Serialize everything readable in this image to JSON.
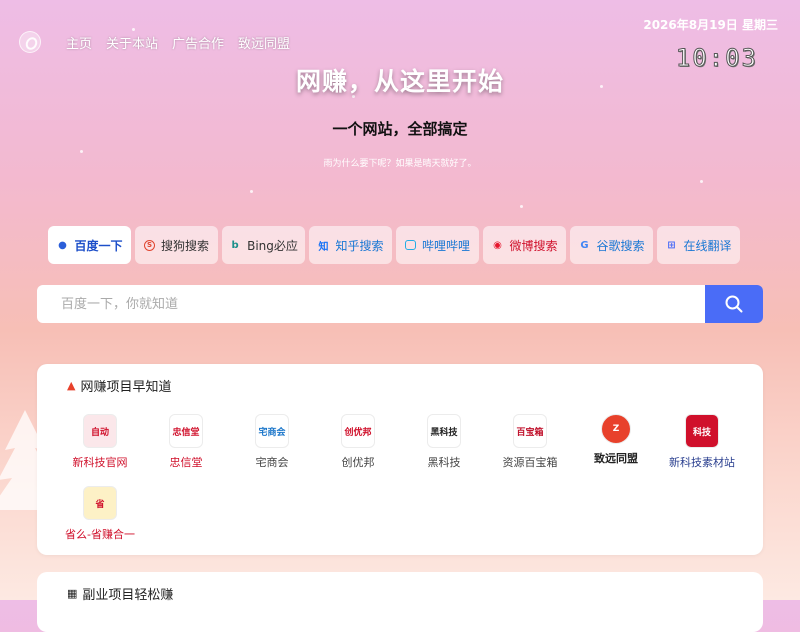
{
  "nav": {
    "items": [
      "主页",
      "关于本站",
      "广告合作",
      "致远同盟"
    ]
  },
  "datetime": {
    "date": "2026年8月19日 星期三",
    "time": "10:03"
  },
  "hero": {
    "title": "网赚，从这里开始",
    "subtitle": "一个网站，全部搞定",
    "note": "雨为什么要下呢？如果是晴天就好了。"
  },
  "search_tabs": [
    {
      "label": "百度一下",
      "icon": "paw-icon",
      "color": "#2b5fd9"
    },
    {
      "label": "搜狗搜索",
      "icon": "sogou-icon",
      "color": "#e0452f"
    },
    {
      "label": "Bing必应",
      "icon": "bing-icon",
      "color": "#1b8f8b"
    },
    {
      "label": "知乎搜索",
      "icon": "zhihu-icon",
      "color": "#1772f6"
    },
    {
      "label": "哔哩哔哩",
      "icon": "bilibili-icon",
      "color": "#23ade5"
    },
    {
      "label": "微博搜索",
      "icon": "weibo-icon",
      "color": "#e6162d"
    },
    {
      "label": "谷歌搜索",
      "icon": "google-icon",
      "color": "#4285f4"
    },
    {
      "label": "在线翻译",
      "icon": "translate-icon",
      "color": "#4a6cf7"
    }
  ],
  "search": {
    "placeholder": "百度一下，你就知道"
  },
  "sections": [
    {
      "title": "网赚项目早知道",
      "icon": "fire-icon",
      "items": [
        {
          "label": "新科技官网",
          "logo_text": "自动",
          "color": "#d0102b"
        },
        {
          "label": "忠信堂",
          "logo_text": "忠信堂",
          "color": "#d0102b"
        },
        {
          "label": "宅商会",
          "logo_text": "宅商会",
          "color": "#444444"
        },
        {
          "label": "创优邦",
          "logo_text": "创优邦",
          "color": "#444444"
        },
        {
          "label": "黑科技",
          "logo_text": "黑科技",
          "color": "#444444"
        },
        {
          "label": "资源百宝箱",
          "logo_text": "百宝箱",
          "color": "#444444"
        },
        {
          "label": "致远同盟",
          "logo_text": "Z",
          "color": "#222222"
        },
        {
          "label": "新科技素材站",
          "logo_text": "科技",
          "color": "#2a3f8f"
        },
        {
          "label": "省么-省赚合一",
          "logo_text": "省",
          "color": "#d0102b"
        }
      ]
    },
    {
      "title": "副业项目轻松赚",
      "icon": "grid-icon"
    }
  ]
}
